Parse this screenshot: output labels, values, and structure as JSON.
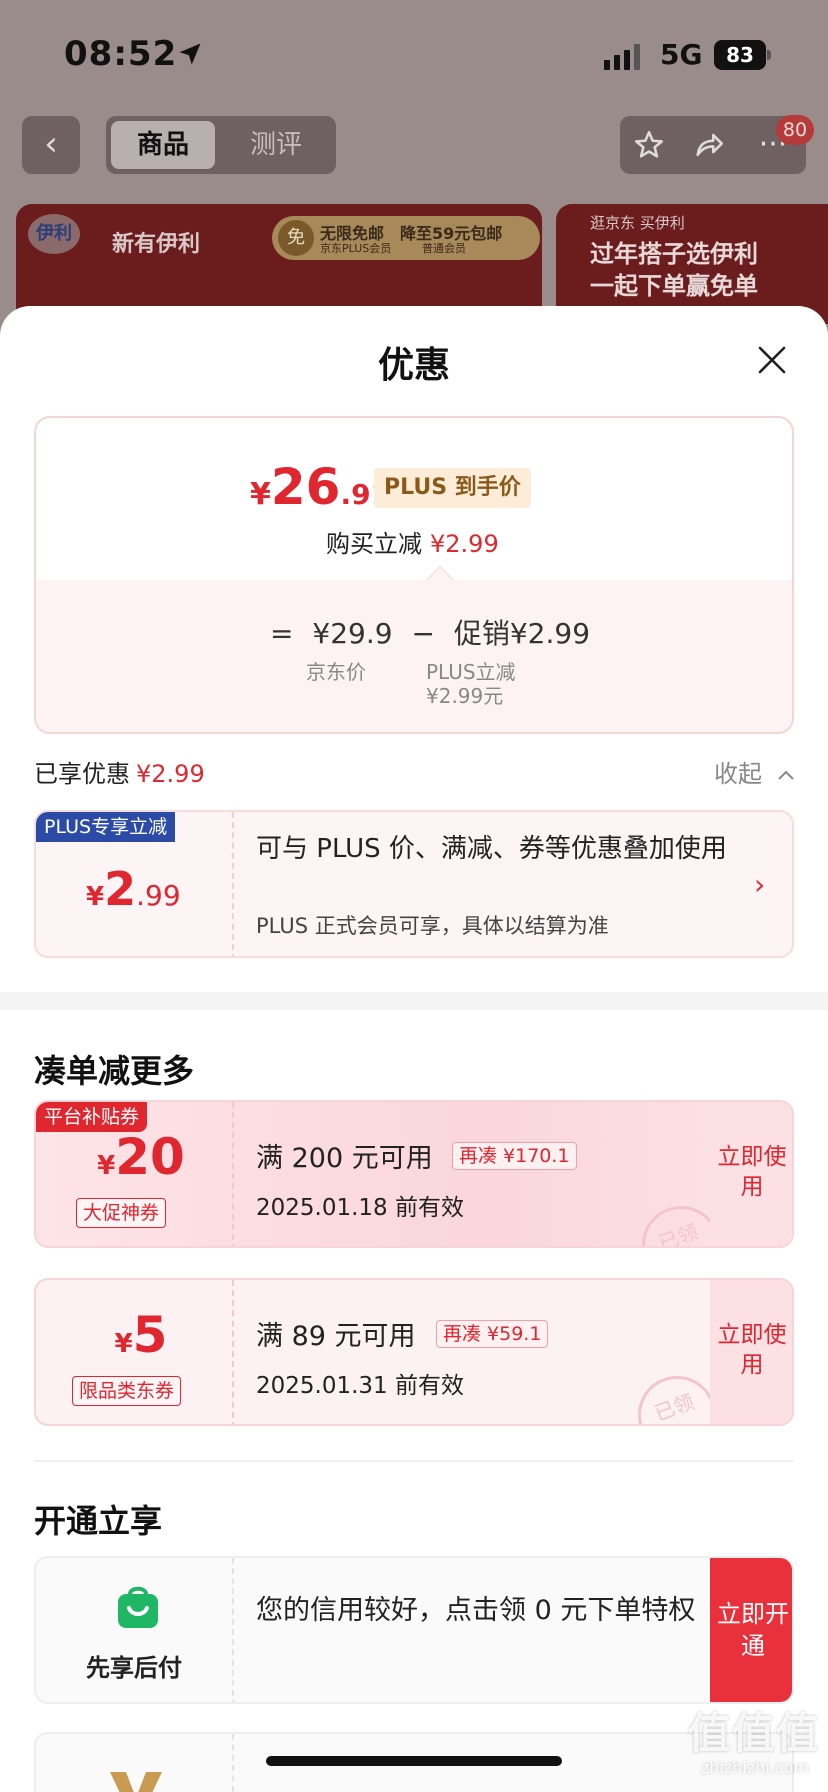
{
  "status_bar": {
    "time": "08:52",
    "network": "5G",
    "battery": "83"
  },
  "nav": {
    "tabs": [
      {
        "label": "商品"
      },
      {
        "label": "测评"
      }
    ],
    "badge_count": "80"
  },
  "background_banners": {
    "left": {
      "logo_text": "伊利",
      "brand_text": "新有伊利",
      "free_icon": "免",
      "pill_title": "无限免邮",
      "pill_sub": "京东PLUS会员",
      "pill_right_title": "降至59元包邮",
      "pill_right_sub": "普通会员"
    },
    "right": {
      "line1": "逛京东 买伊利",
      "line2": "过年搭子选伊利",
      "line3": "一起下单赢免单"
    }
  },
  "sheet": {
    "title": "优惠",
    "price_card": {
      "currency": "¥",
      "price_int": "26",
      "price_dec": ".91",
      "plus_tag": "PLUS 到手价",
      "buy_reduce_label": "购买立减",
      "buy_reduce_value": "¥2.99",
      "eq": "=",
      "jd_price": "¥29.9",
      "minus": "−",
      "promo_label": "促销",
      "promo_value": "¥2.99",
      "jd_price_label": "京东价",
      "plus_reduce_label": "PLUS立减",
      "plus_reduce_value": "¥2.99元"
    },
    "enjoyed_label": "已享优惠",
    "enjoyed_value": "¥2.99",
    "collapse_label": "收起",
    "plus_card": {
      "tag": "PLUS专享立减",
      "currency": "¥",
      "amount_int": "2",
      "amount_dec": ".99",
      "line1": "可与 PLUS 价、满减、券等优惠叠加使用",
      "line2": "PLUS 正式会员可享，具体以结算为准"
    },
    "section_more": "凑单减更多",
    "coupons": [
      {
        "tag": "平台补贴券",
        "currency": "¥",
        "amount": "20",
        "kind": "大促神券",
        "condition": "满 200 元可用",
        "more": "再凑 ¥170.1",
        "valid": "2025.01.18 前有效",
        "use_label": "立即使用",
        "stamp": "已领"
      },
      {
        "currency": "¥",
        "amount": "5",
        "kind": "限品类东券",
        "condition": "满 89 元可用",
        "more": "再凑 ¥59.1",
        "valid": "2025.01.31 前有效",
        "use_label": "立即使用",
        "stamp": "已领"
      }
    ],
    "section_open": "开通立享",
    "service": {
      "label": "先享后付",
      "desc": "您的信用较好，点击领 0 元下单特权",
      "open_label": "立即开通"
    }
  },
  "watermark": {
    "main": "值值值",
    "sub": "zhizhizhi.com"
  },
  "colors": {
    "accent_red": "#e0262f",
    "plus_blue": "#2b4ba6",
    "plus_gold_bg": "#fcecd8"
  }
}
